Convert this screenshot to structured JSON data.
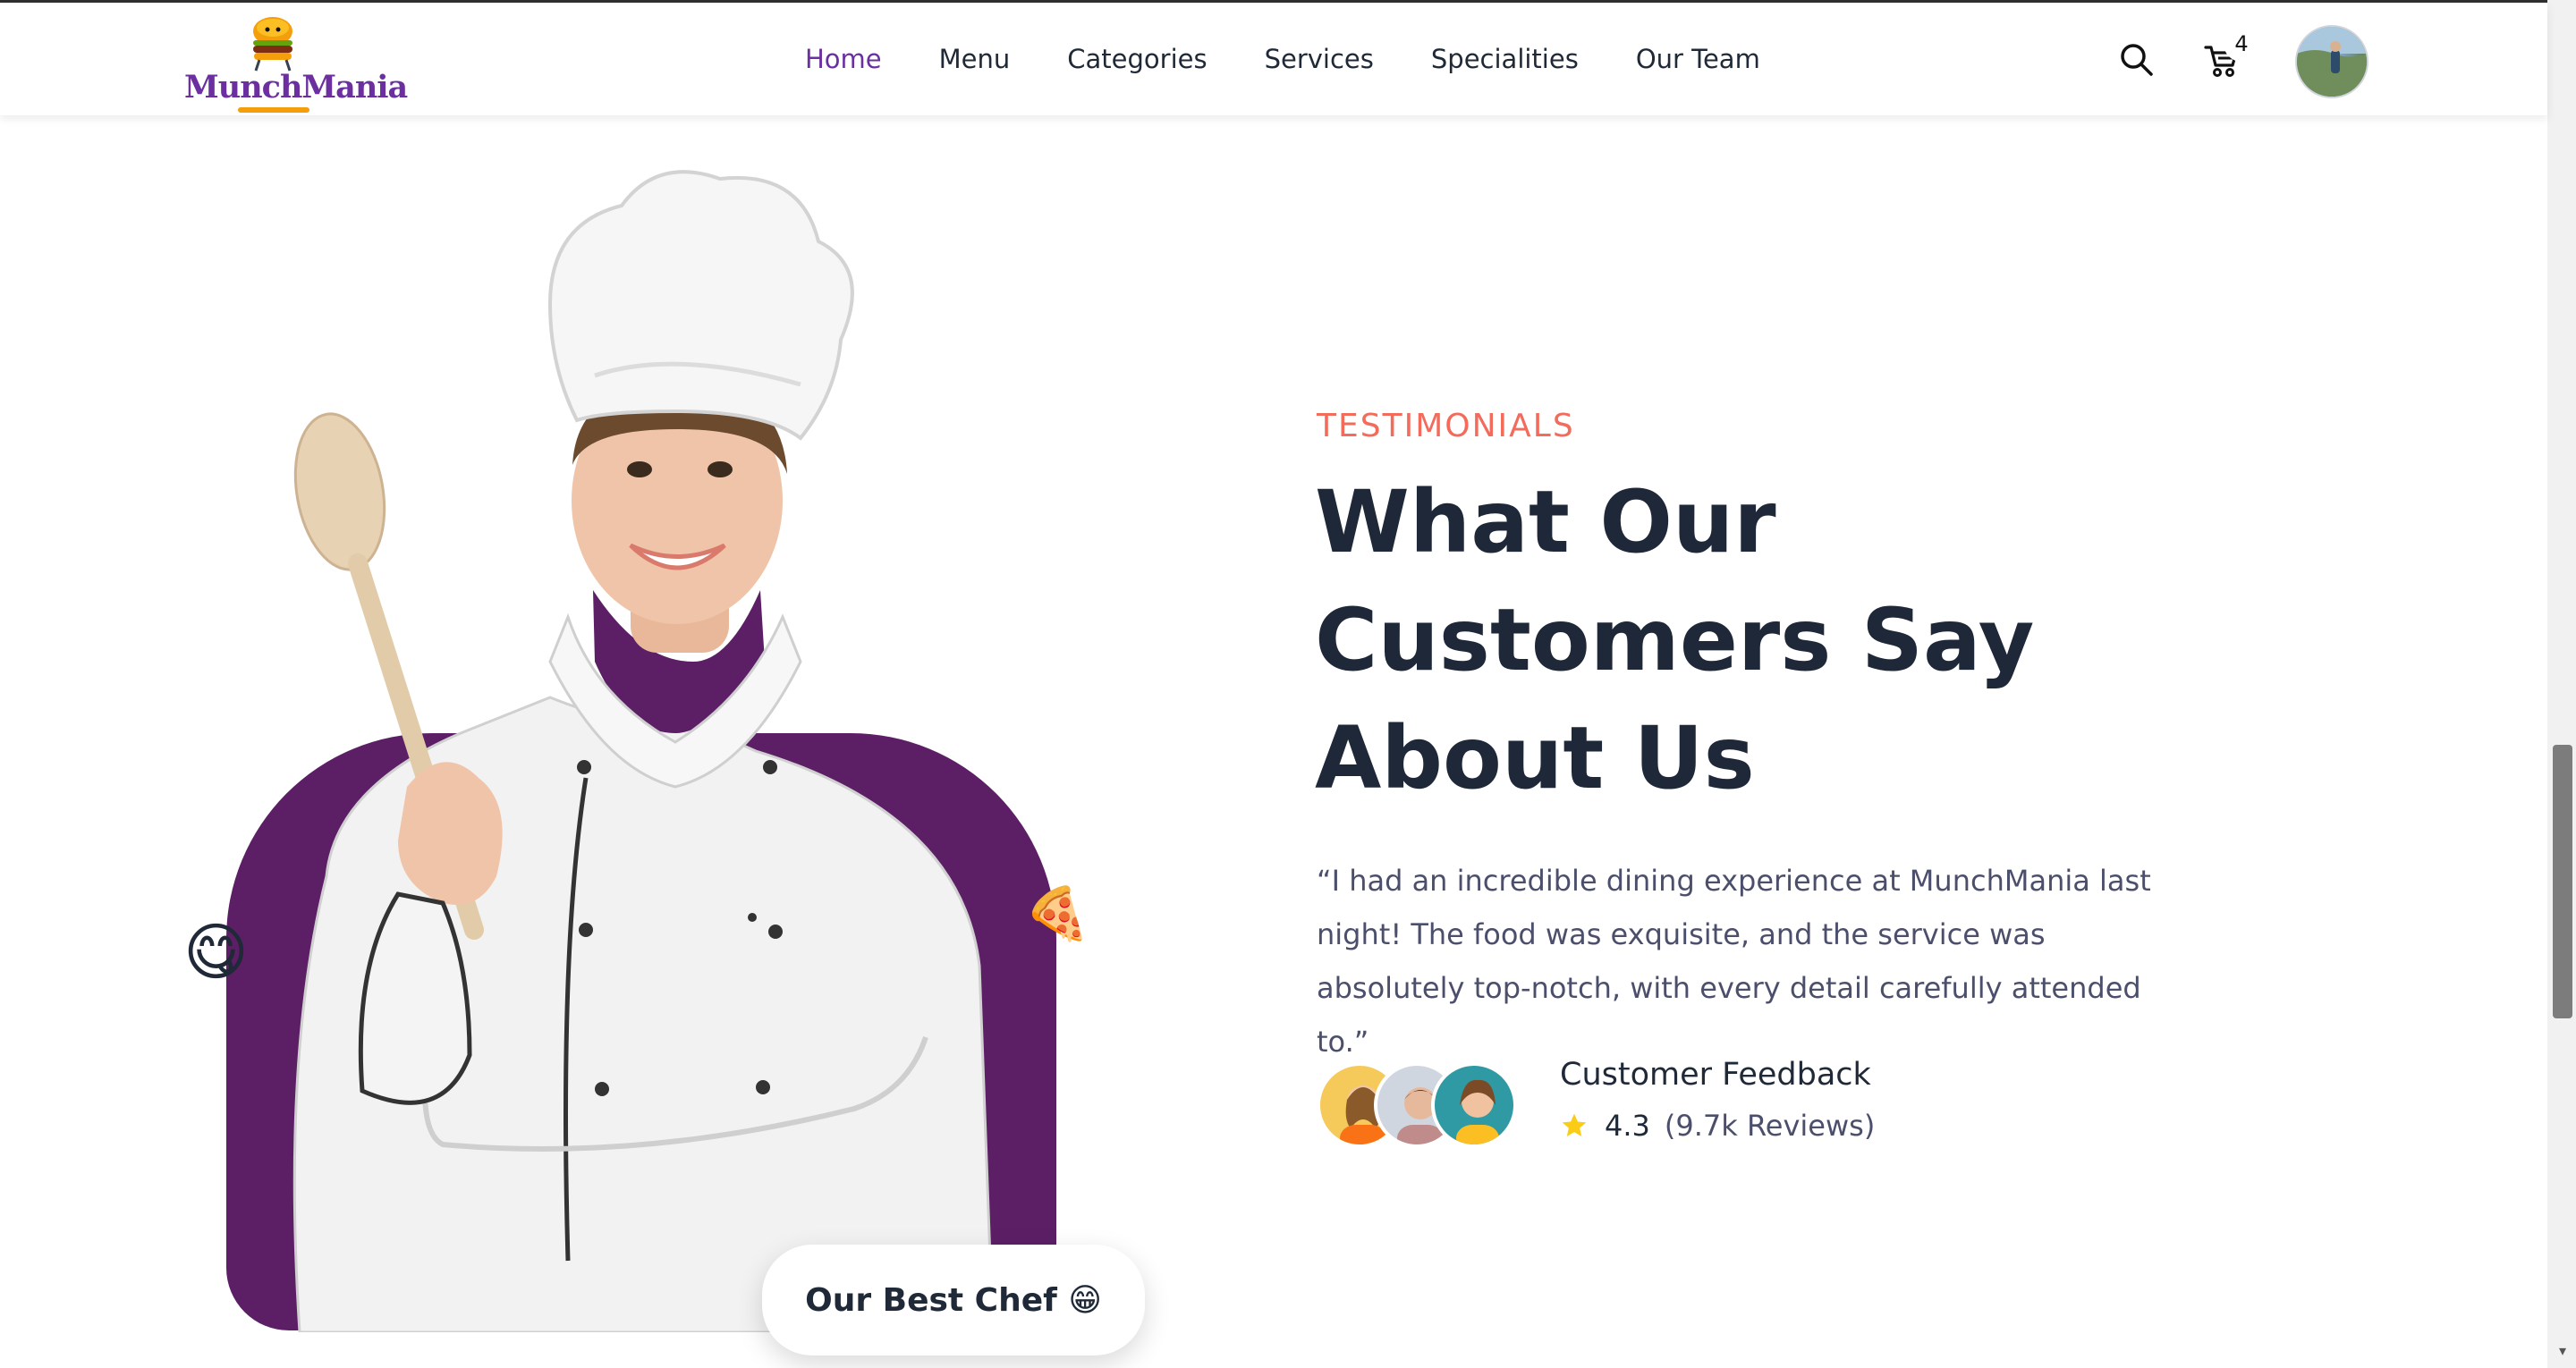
{
  "brand": {
    "name": "MunchMania"
  },
  "nav": {
    "items": [
      {
        "label": "Home",
        "active": true
      },
      {
        "label": "Menu",
        "active": false
      },
      {
        "label": "Categories",
        "active": false
      },
      {
        "label": "Services",
        "active": false
      },
      {
        "label": "Specialities",
        "active": false
      },
      {
        "label": "Our Team",
        "active": false
      }
    ]
  },
  "header": {
    "cart_count": "4",
    "icons": [
      "search-icon",
      "cart-icon",
      "user-avatar"
    ]
  },
  "hero": {
    "best_chef_label": "Our Best Chef 😁",
    "emoji_left": "😋",
    "emoji_right": "🍕"
  },
  "testimonials": {
    "eyebrow": "TESTIMONIALS",
    "title_line1": "What Our",
    "title_line2": "Customers Say",
    "title_line3": "About Us",
    "quote": "“I had an incredible dining experience at MunchMania last night! The food was exquisite, and the service was absolutely top-notch, with every detail carefully attended to.”",
    "feedback_title": "Customer Feedback",
    "rating": "4.3",
    "reviews": "(9.7k Reviews)"
  },
  "colors": {
    "accent_purple": "#6b2fa0",
    "hero_purple": "#5c1f66",
    "eyebrow_coral": "#f26b5b",
    "heading_dark": "#1e2838",
    "star_yellow": "#facc15"
  }
}
